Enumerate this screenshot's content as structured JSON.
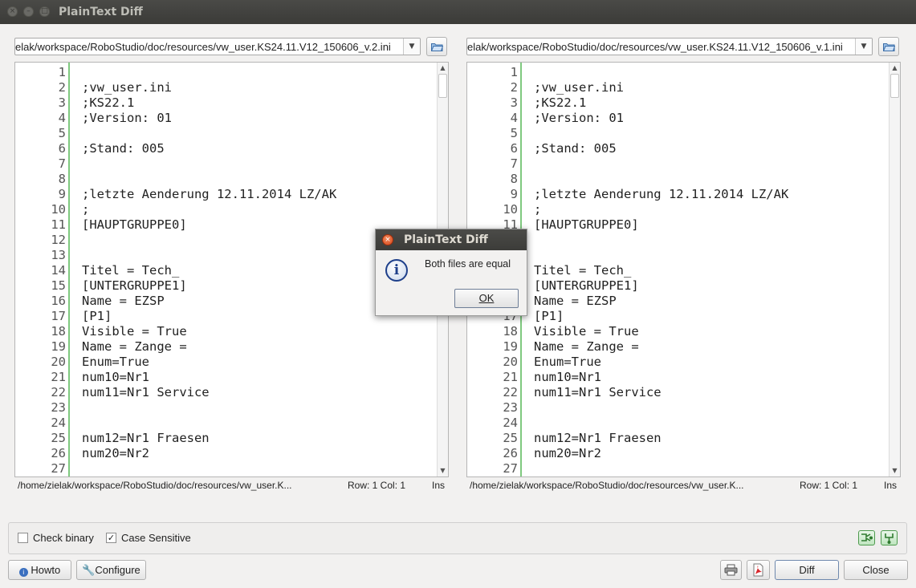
{
  "window": {
    "title": "PlainText Diff"
  },
  "left": {
    "path": "elak/workspace/RoboStudio/doc/resources/vw_user.KS24.11.V12_150606_v.2.ini",
    "status_path": "/home/zielak/workspace/RoboStudio/doc/resources/vw_user.K...",
    "row_col": "Row: 1 Col: 1",
    "mode": "Ins"
  },
  "right": {
    "path": "elak/workspace/RoboStudio/doc/resources/vw_user.KS24.11.V12_150606_v.1.ini",
    "status_path": "/home/zielak/workspace/RoboStudio/doc/resources/vw_user.K...",
    "row_col": "Row: 1 Col: 1",
    "mode": "Ins"
  },
  "lines": [
    {
      "n": "1",
      "text": ""
    },
    {
      "n": "2",
      "text": ";vw_user.ini"
    },
    {
      "n": "3",
      "text": ";KS22.1"
    },
    {
      "n": "4",
      "text": ";Version: 01"
    },
    {
      "n": "5",
      "text": ""
    },
    {
      "n": "6",
      "text": ";Stand: 005"
    },
    {
      "n": "7",
      "text": ""
    },
    {
      "n": "8",
      "text": ""
    },
    {
      "n": "9",
      "text": ";letzte Aenderung 12.11.2014 LZ/AK"
    },
    {
      "n": "10",
      "text": ";"
    },
    {
      "n": "11",
      "text": "[HAUPTGRUPPE0]"
    },
    {
      "n": "12",
      "text": ""
    },
    {
      "n": "13",
      "text": ""
    },
    {
      "n": "14",
      "text": "Titel = Tech_"
    },
    {
      "n": "15",
      "text": "[UNTERGRUPPE1]"
    },
    {
      "n": "16",
      "text": "Name = EZSP"
    },
    {
      "n": "17",
      "text": "[P1]"
    },
    {
      "n": "18",
      "text": "Visible = True"
    },
    {
      "n": "19",
      "text": "Name = Zange ="
    },
    {
      "n": "20",
      "text": "Enum=True"
    },
    {
      "n": "21",
      "text": "num10=Nr1"
    },
    {
      "n": "22",
      "text": "num11=Nr1 Service"
    },
    {
      "n": "23",
      "text": ""
    },
    {
      "n": "24",
      "text": ""
    },
    {
      "n": "25",
      "text": "num12=Nr1 Fraesen"
    },
    {
      "n": "26",
      "text": "num20=Nr2"
    },
    {
      "n": "27",
      "text": ""
    }
  ],
  "options": {
    "check_binary_label": "Check binary",
    "check_binary_checked": false,
    "case_sensitive_label": "Case Sensitive",
    "case_sensitive_checked": true
  },
  "buttons": {
    "howto": "Howto",
    "configure": "Configure",
    "diff": "Diff",
    "close": "Close"
  },
  "dialog": {
    "title": "PlainText Diff",
    "message": "Both files are equal",
    "ok": "OK"
  },
  "icons": {
    "open_file": "folder-open-icon",
    "print": "printer-icon",
    "pdf": "pdf-icon",
    "info": "info-icon",
    "howto": "info-circle-icon",
    "configure": "wrench-icon"
  }
}
